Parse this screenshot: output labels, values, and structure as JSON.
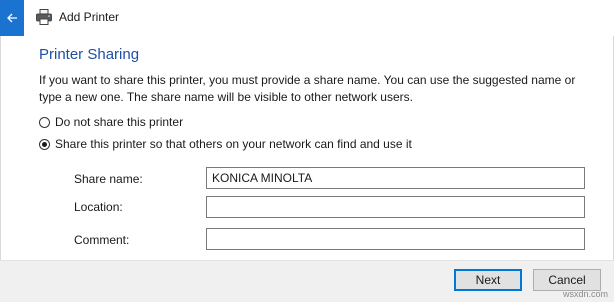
{
  "window": {
    "title": "Add Printer",
    "accent_color": "#1a73d0"
  },
  "page": {
    "heading": "Printer Sharing",
    "description": "If you want to share this printer, you must provide a share name. You can use the suggested name or type a new one. The share name will be visible to other network users."
  },
  "sharing_options": [
    {
      "label": "Do not share this printer",
      "selected": false
    },
    {
      "label": "Share this printer so that others on your network can find and use it",
      "selected": true
    }
  ],
  "fields": {
    "share_name": {
      "label": "Share name:",
      "value": "KONICA MINOLTA"
    },
    "location": {
      "label": "Location:",
      "value": ""
    },
    "comment": {
      "label": "Comment:",
      "value": ""
    }
  },
  "buttons": {
    "next": "Next",
    "cancel": "Cancel"
  },
  "watermark": "wsxdn.com"
}
